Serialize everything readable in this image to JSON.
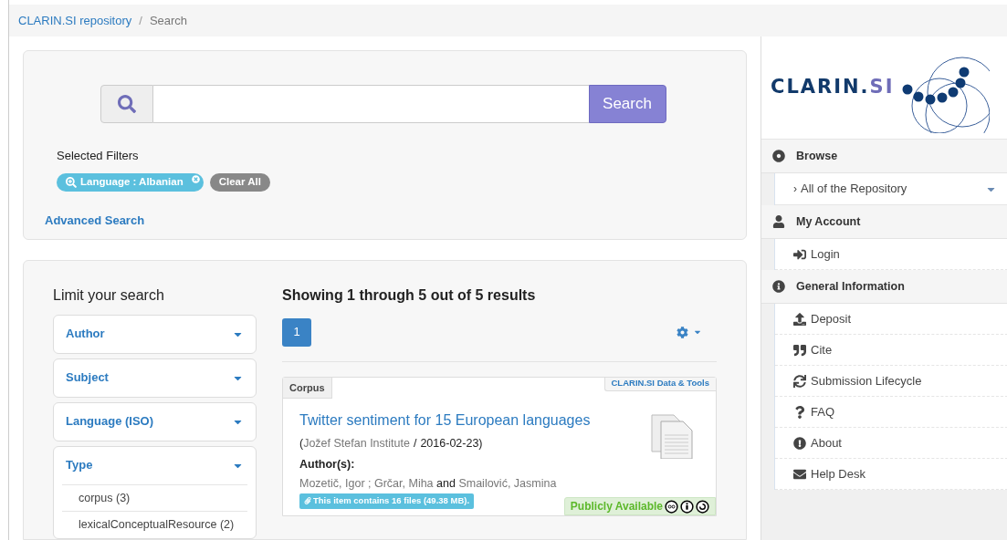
{
  "breadcrumb": [
    {
      "label": "CLARIN.SI repository",
      "kind": "link"
    },
    {
      "label": "/",
      "kind": "separator"
    },
    {
      "label": "Search",
      "kind": "current"
    }
  ],
  "search": {
    "button": "Search"
  },
  "selected_filters": {
    "title": "Selected Filters",
    "filters": [
      {
        "label": "Language : Albanian"
      }
    ],
    "clear": "Clear All"
  },
  "advanced_search": "Advanced Search",
  "facets": {
    "title": "Limit your search",
    "groups": [
      {
        "label": "Author",
        "expanded": false
      },
      {
        "label": "Subject",
        "expanded": false
      },
      {
        "label": "Language (ISO)",
        "expanded": false
      },
      {
        "label": "Type",
        "expanded": true,
        "items": [
          "corpus (3)",
          "lexicalConceptualResource (2)"
        ]
      }
    ]
  },
  "results": {
    "summary": "Showing 1 through 5 out of 5 results",
    "pages": [
      {
        "label": "1",
        "selected": true
      }
    ],
    "items": [
      {
        "type": "Corpus",
        "collection": "CLARIN.SI Data & Tools",
        "title": "Twitter sentiment for 15 European languages",
        "origin": [
          {
            "text": "(",
            "kind": "punct"
          },
          {
            "text": "Jožef Stefan Institute",
            "kind": "publisher"
          },
          {
            "text": "/",
            "kind": "punct"
          },
          {
            "text": "2016-02-23",
            "kind": "date"
          },
          {
            "text": ")",
            "kind": "punct"
          }
        ],
        "authors_label": "Author(s):",
        "authors": [
          {
            "text": "Mozetič, Igor ; Grčar, Miha",
            "kind": "name"
          },
          {
            "text": "and",
            "kind": "joiner"
          },
          {
            "text": "Smailović, Jasmina",
            "kind": "name"
          }
        ],
        "files": "This item contains 16 files (49.38 MB).",
        "availability": "Publicly Available"
      }
    ]
  },
  "logo": {
    "main": "CLARIN.",
    "accent": "SI"
  },
  "sidebar": [
    {
      "heading": "Browse",
      "items": [
        {
          "label": "All of the Repository",
          "kind": "scope",
          "marker": "›"
        }
      ]
    },
    {
      "heading": "My Account",
      "items": [
        {
          "label": "Login",
          "kind": "link"
        }
      ]
    },
    {
      "heading": "General Information",
      "items": [
        {
          "label": "Deposit",
          "kind": "link"
        },
        {
          "label": "Cite",
          "kind": "link"
        },
        {
          "label": "Submission Lifecycle",
          "kind": "link"
        },
        {
          "label": "FAQ",
          "kind": "link"
        },
        {
          "label": "About",
          "kind": "link"
        },
        {
          "label": "Help Desk",
          "kind": "link"
        }
      ]
    }
  ]
}
